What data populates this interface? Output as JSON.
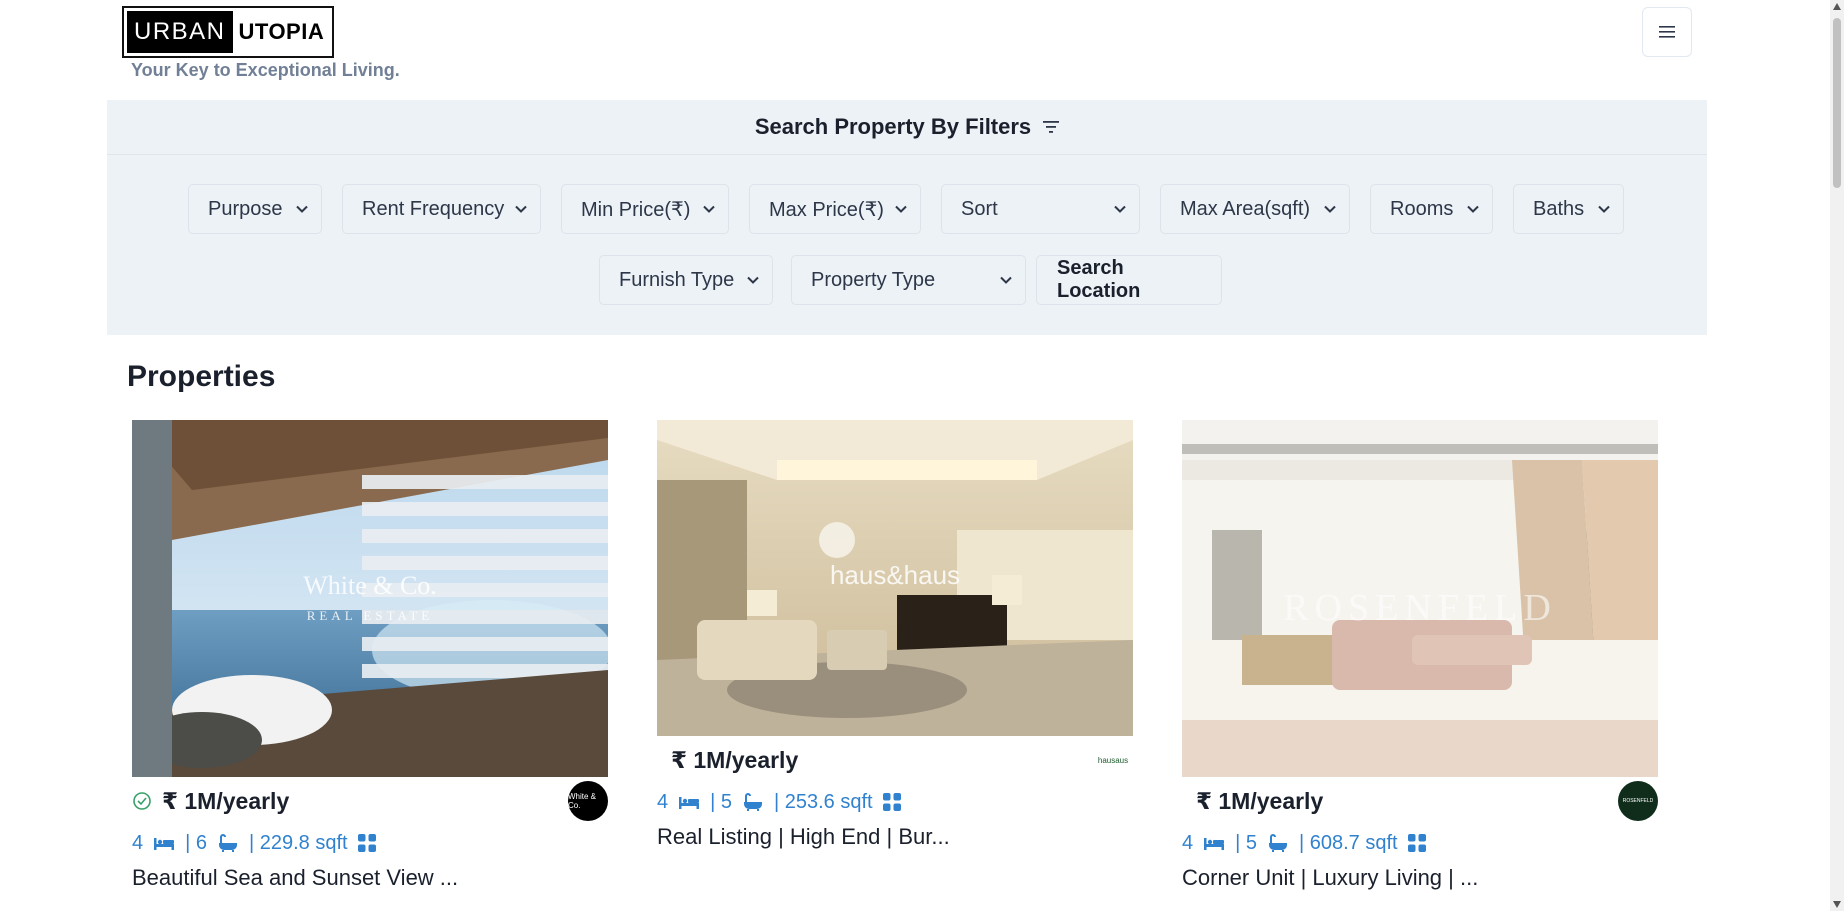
{
  "brand": {
    "logo_left": "URBAN",
    "logo_right": "UTOPIA",
    "tagline": "Your Key to Exceptional Living."
  },
  "filters": {
    "title": "Search Property By Filters",
    "row1": [
      "Purpose",
      "Rent Frequency",
      "Min Price(₹)",
      "Max Price(₹)",
      "Sort",
      "Max Area(sqft)",
      "Rooms",
      "Baths"
    ],
    "row2": [
      "Furnish Type",
      "Property Type"
    ],
    "location_button": "Search Location"
  },
  "section_title": "Properties",
  "properties": [
    {
      "price": "₹ 1M/yearly",
      "verified": true,
      "rooms": "4",
      "baths": "| 6",
      "area": "| 229.8 sqft",
      "title": "Beautiful Sea and Sunset View ...",
      "agency_label": "White & Co.",
      "watermark": "White & Co.",
      "watermark_sub": "REAL ESTATE",
      "agency_color": "#000000"
    },
    {
      "price": "₹ 1M/yearly",
      "verified": false,
      "rooms": "4",
      "baths": "| 5",
      "area": "| 253.6 sqft",
      "title": "Real Listing | High End | Bur...",
      "agency_label": "hausaus",
      "watermark": "haus&haus",
      "watermark_sub": "",
      "agency_color": "#ffffff"
    },
    {
      "price": "₹ 1M/yearly",
      "verified": false,
      "rooms": "4",
      "baths": "| 5",
      "area": "| 608.7 sqft",
      "title": "Corner Unit | Luxury Living | ...",
      "agency_label": "ROSENFELD",
      "watermark": "ROSENFELD",
      "watermark_sub": "",
      "agency_color": "#0f2d1a"
    }
  ],
  "colors": {
    "accent": "#3182ce",
    "filter_bg": "#edf2f7",
    "verified": "#38a169"
  },
  "icons": {
    "menu": "hamburger-icon",
    "filter": "filter-icon",
    "bed": "bed-icon",
    "bath": "bath-icon",
    "area": "grid-icon",
    "verified": "check-circle-icon"
  }
}
